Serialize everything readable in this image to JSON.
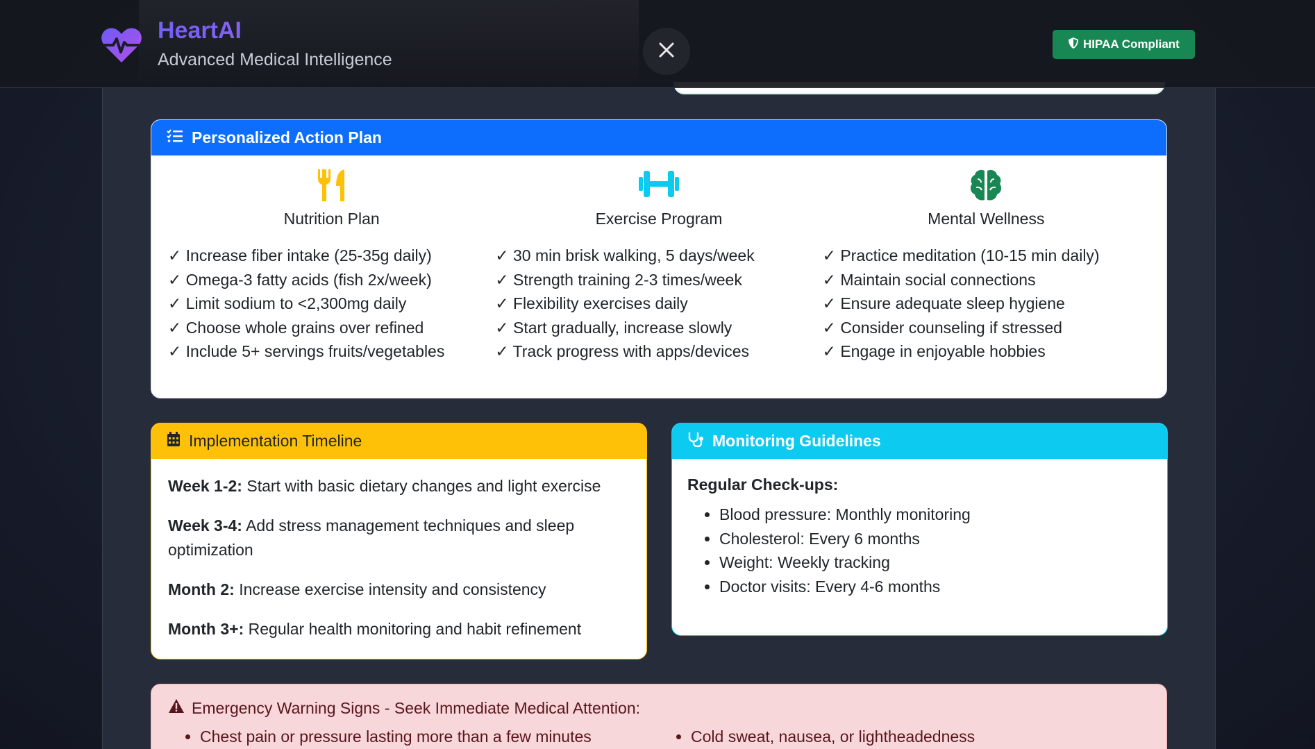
{
  "navbar": {
    "title": "HeartAI",
    "subtitle": "Advanced Medical Intelligence",
    "badge": "HIPAA Compliant",
    "icons": {
      "logo": "heart-pulse-icon",
      "close": "close-icon",
      "badge": "shield-icon"
    }
  },
  "action_plan": {
    "title": "Personalized Action Plan",
    "columns": [
      {
        "heading": "Nutrition Plan",
        "icon": "utensils-icon",
        "items": [
          "✓ Increase fiber intake (25-35g daily)",
          "✓ Omega-3 fatty acids (fish 2x/week)",
          "✓ Limit sodium to <2,300mg daily",
          "✓ Choose whole grains over refined",
          "✓ Include 5+ servings fruits/vegetables"
        ]
      },
      {
        "heading": "Exercise Program",
        "icon": "dumbbell-icon",
        "items": [
          "✓ 30 min brisk walking, 5 days/week",
          "✓ Strength training 2-3 times/week",
          "✓ Flexibility exercises daily",
          "✓ Start gradually, increase slowly",
          "✓ Track progress with apps/devices"
        ]
      },
      {
        "heading": "Mental Wellness",
        "icon": "brain-icon",
        "items": [
          "✓ Practice meditation (10-15 min daily)",
          "✓ Maintain social connections",
          "✓ Ensure adequate sleep hygiene",
          "✓ Consider counseling if stressed",
          "✓ Engage in enjoyable hobbies"
        ]
      }
    ]
  },
  "timeline": {
    "title": "Implementation Timeline",
    "items": [
      {
        "label": "Week 1-2:",
        "text": " Start with basic dietary changes and light exercise"
      },
      {
        "label": "Week 3-4:",
        "text": " Add stress management techniques and sleep optimization"
      },
      {
        "label": "Month 2:",
        "text": " Increase exercise intensity and consistency"
      },
      {
        "label": "Month 3+:",
        "text": " Regular health monitoring and habit refinement"
      }
    ]
  },
  "monitoring": {
    "title": "Monitoring Guidelines",
    "subtitle": "Regular Check-ups:",
    "items": [
      "Blood pressure: Monthly monitoring",
      "Cholesterol: Every 6 months",
      "Weight: Weekly tracking",
      "Doctor visits: Every 4-6 months"
    ]
  },
  "warning": {
    "title": "Emergency Warning Signs - Seek Immediate Medical Attention:",
    "left_items": [
      "Chest pain or pressure lasting more than a few minutes"
    ],
    "right_items": [
      "Cold sweat, nausea, or lightheadedness"
    ]
  },
  "colors": {
    "primary": "#0d6efd",
    "warning": "#ffc107",
    "info": "#0dcaf0",
    "success": "#198754",
    "brand": "#8b5cf6"
  }
}
